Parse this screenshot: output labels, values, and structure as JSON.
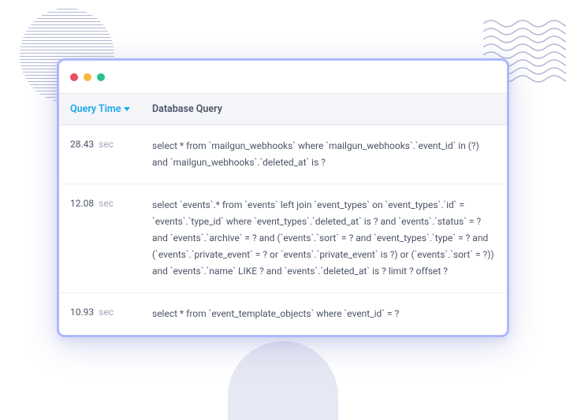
{
  "table": {
    "headers": {
      "time": "Query Time",
      "query": "Database Query"
    },
    "time_unit": "sec",
    "rows": [
      {
        "time": "28.43",
        "query": "select * from `mailgun_webhooks` where `mailgun_webhooks`.`event_id` in (?) and `mailgun_webhooks`.`deleted_at` is ?"
      },
      {
        "time": "12.08",
        "query": "select `events`.* from `events` left join `event_types` on `event_types`.`id` = `events`.`type_id` where `event_types`.`deleted_at` is ? and `events`.`status` = ? and `events`.`archive` = ? and (`events`.`sort` = ? and `event_types`.`type` = ? and (`events`.`private_event` = ? or `events`.`private_event` is ?) or (`events`.`sort` = ?)) and `events`.`name` LIKE ? and `events`.`deleted_at` is ? limit ? offset ?"
      },
      {
        "time": "10.93",
        "query": "select * from `event_template_objects` where `event_id` = ?"
      }
    ]
  }
}
